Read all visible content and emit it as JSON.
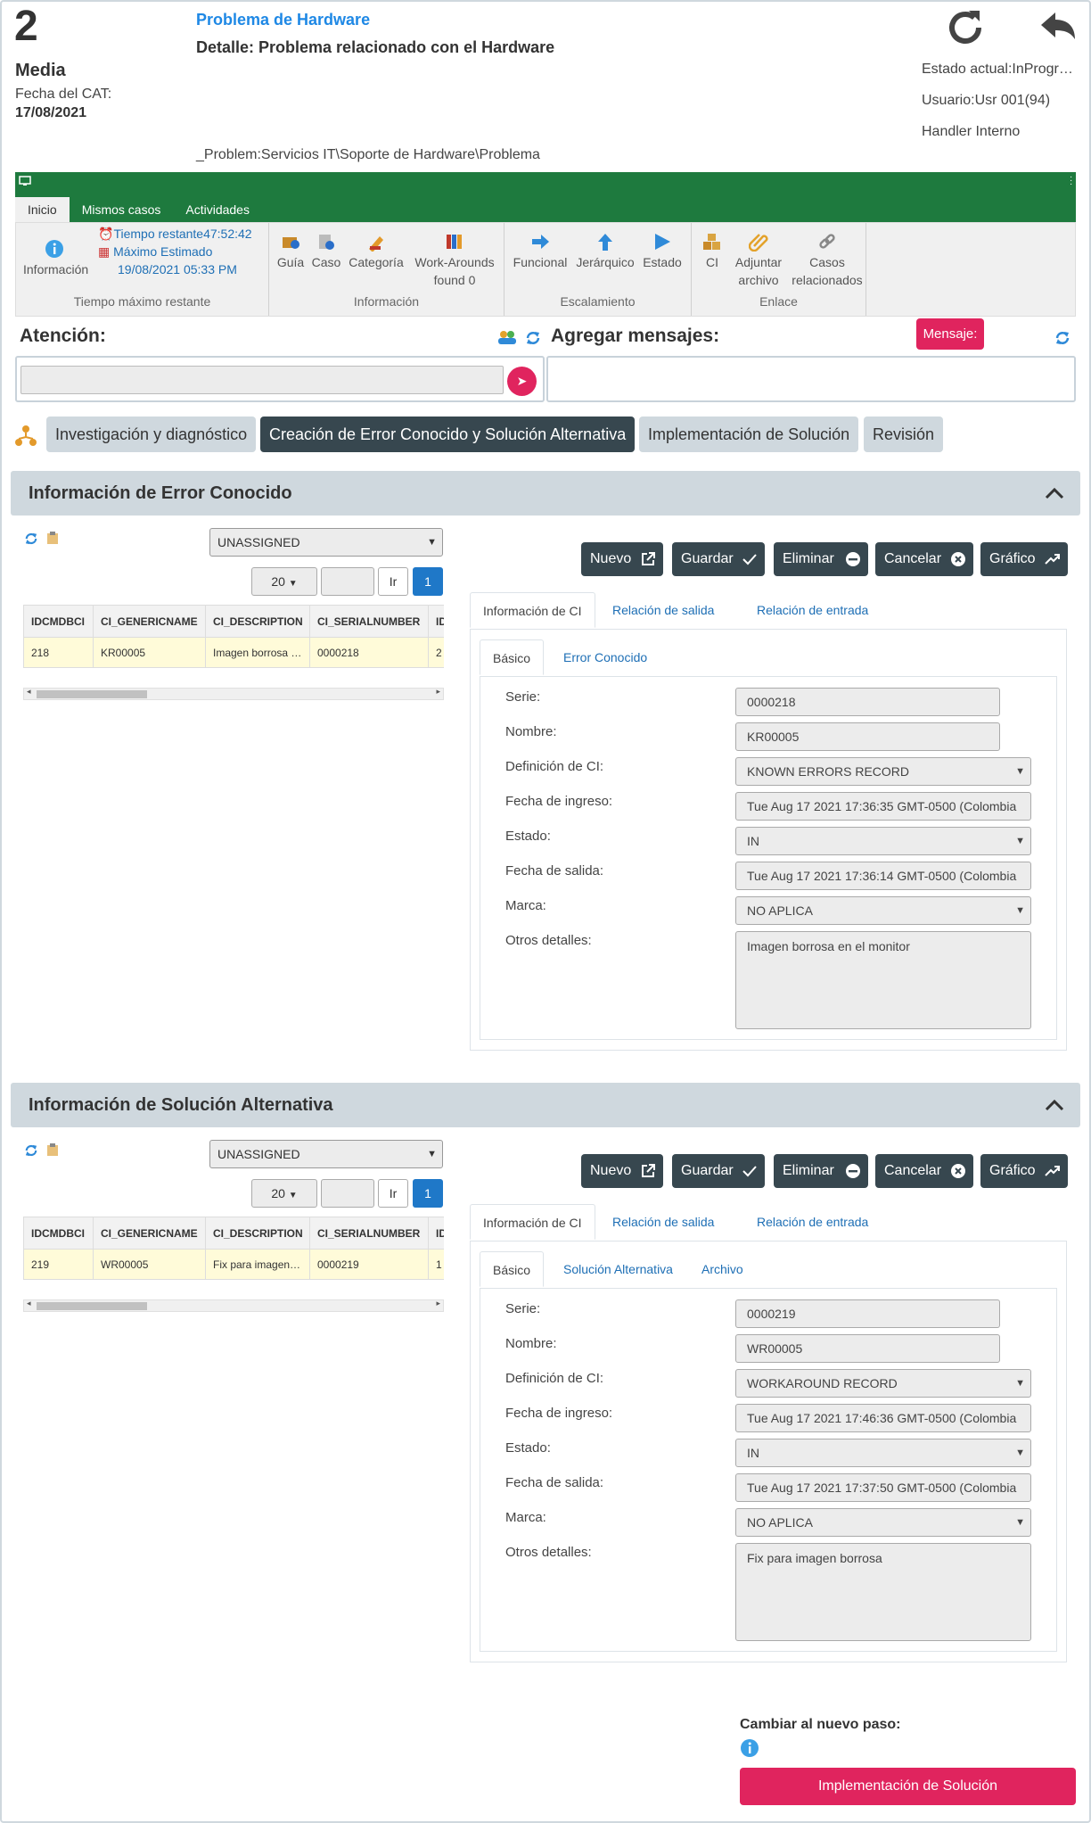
{
  "header": {
    "case_number": "2",
    "priority": "Media",
    "cat_date_label": "Fecha del CAT:",
    "cat_date": "17/08/2021",
    "title": "Problema de Hardware",
    "detail": "Detalle: Problema relacionado con el Hardware",
    "path": "_Problem:Servicios IT\\Soporte de Hardware\\Problema",
    "state": "Estado actual:InProgr…",
    "user": "Usuario:Usr 001(94)",
    "handler": "Handler Interno"
  },
  "ribbon": {
    "tabs": [
      "Inicio",
      "Mismos casos",
      "Actividades"
    ],
    "info_label": "Información",
    "time_left": "Tiempo restante47:52:42",
    "max_estimated": "Máximo Estimado",
    "max_date": "19/08/2021 05:33 PM",
    "group_time": "Tiempo máximo restante",
    "guide": "Guía",
    "case": "Caso",
    "category": "Categoría",
    "workarounds": "Work-Arounds",
    "workarounds_found": "found 0",
    "group_info": "Información",
    "functional": "Funcional",
    "hierarchical": "Jerárquico",
    "status": "Estado",
    "group_escalation": "Escalamiento",
    "ci": "CI",
    "attach_1": "Adjuntar",
    "attach_2": "archivo",
    "related_1": "Casos",
    "related_2": "relacionados",
    "group_link": "Enlace"
  },
  "attention": {
    "label": "Atención:",
    "input_value": ""
  },
  "messages": {
    "label": "Agregar mensajes:",
    "button": "Mensaje:"
  },
  "steps": [
    "Investigación y diagnóstico",
    "Creación de Error Conocido y Solución Alternativa",
    "Implementación de Solución",
    "Revisión"
  ],
  "panel1": {
    "title": "Información de Error Conocido",
    "filter": "UNASSIGNED",
    "page_size": "20",
    "go": "Ir",
    "page": "1",
    "columns": [
      "IDCMDBCI",
      "CI_GENERICNAME",
      "CI_DESCRIPTION",
      "CI_SERIALNUMBER",
      "ID"
    ],
    "row": [
      "218",
      "KR00005",
      "Imagen borrosa …",
      "0000218",
      "2"
    ],
    "buttons": [
      "Nuevo",
      "Guardar",
      "Eliminar",
      "Cancelar",
      "Gráfico"
    ],
    "tabs": [
      "Información de CI",
      "Relación de salida",
      "Relación de entrada"
    ],
    "subtabs": [
      "Básico",
      "Error Conocido"
    ],
    "fields": {
      "serie_label": "Serie:",
      "serie": "0000218",
      "nombre_label": "Nombre:",
      "nombre": "KR00005",
      "def_label": "Definición de CI:",
      "def": "KNOWN ERRORS RECORD",
      "ingreso_label": "Fecha de ingreso:",
      "ingreso": "Tue Aug 17 2021 17:36:35 GMT-0500 (Colombia",
      "estado_label": "Estado:",
      "estado": "IN",
      "salida_label": "Fecha de salida:",
      "salida": "Tue Aug 17 2021 17:36:14 GMT-0500 (Colombia",
      "marca_label": "Marca:",
      "marca": "NO APLICA",
      "otros_label": "Otros detalles:",
      "otros": "Imagen borrosa en el monitor"
    }
  },
  "panel2": {
    "title": "Información de Solución Alternativa",
    "filter": "UNASSIGNED",
    "page_size": "20",
    "go": "Ir",
    "page": "1",
    "columns": [
      "IDCMDBCI",
      "CI_GENERICNAME",
      "CI_DESCRIPTION",
      "CI_SERIALNUMBER",
      "ID"
    ],
    "row": [
      "219",
      "WR00005",
      "Fix para imagen…",
      "0000219",
      "1"
    ],
    "buttons": [
      "Nuevo",
      "Guardar",
      "Eliminar",
      "Cancelar",
      "Gráfico"
    ],
    "tabs": [
      "Información de CI",
      "Relación de salida",
      "Relación de entrada"
    ],
    "subtabs": [
      "Básico",
      "Solución Alternativa",
      "Archivo"
    ],
    "fields": {
      "serie_label": "Serie:",
      "serie": "0000219",
      "nombre_label": "Nombre:",
      "nombre": "WR00005",
      "def_label": "Definición de CI:",
      "def": "WORKAROUND RECORD",
      "ingreso_label": "Fecha de ingreso:",
      "ingreso": "Tue Aug 17 2021 17:46:36 GMT-0500 (Colombia",
      "estado_label": "Estado:",
      "estado": "IN",
      "salida_label": "Fecha de salida:",
      "salida": "Tue Aug 17 2021 17:37:50 GMT-0500 (Colombia",
      "marca_label": "Marca:",
      "marca": "NO APLICA",
      "otros_label": "Otros detalles:",
      "otros": "Fix para imagen borrosa"
    }
  },
  "next_step": {
    "label": "Cambiar al nuevo paso:",
    "button": "Implementación de Solución"
  },
  "colors": {
    "accent_blue": "#1e88e5",
    "ribbon_green": "#1e7a3e",
    "pink": "#e0245e",
    "dark_button": "#37474f",
    "panel_header": "#cfd8de",
    "row_highlight": "#fffbd9"
  }
}
